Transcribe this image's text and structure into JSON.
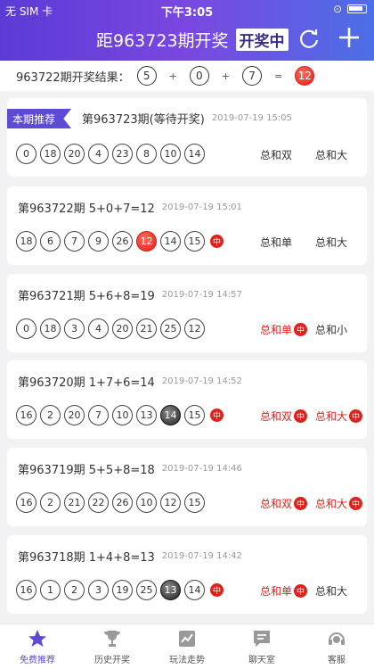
{
  "status": {
    "carrier": "无 SIM 卡",
    "time": "下午3:05"
  },
  "header": {
    "title": "距963723期开奖",
    "badge": "开奖中"
  },
  "result": {
    "label": "963722期开奖结果：",
    "n1": "5",
    "n2": "0",
    "n3": "7",
    "sum": "12",
    "op_plus": "+",
    "op_eq": "="
  },
  "current": {
    "tag": "本期推荐",
    "title": "第963723期(等待开奖)",
    "time": "2019-07-19 15:05",
    "balls": [
      "0",
      "18",
      "20",
      "4",
      "23",
      "8",
      "10",
      "14"
    ],
    "tag1": "总和双",
    "tag2": "总和大"
  },
  "history": [
    {
      "title": "第963722期 5+0+7=12",
      "time": "2019-07-19 15:01",
      "balls": [
        "18",
        "6",
        "7",
        "9",
        "26",
        "12",
        "14",
        "15"
      ],
      "ball_styles": [
        "",
        "",
        "",
        "",
        "",
        "red",
        "",
        ""
      ],
      "last_hit": true,
      "tag1": "总和单",
      "tag1_hit": false,
      "tag2": "总和大",
      "tag2_hit": false
    },
    {
      "title": "第963721期 5+6+8=19",
      "time": "2019-07-19 14:57",
      "balls": [
        "0",
        "18",
        "3",
        "4",
        "20",
        "21",
        "25",
        "12"
      ],
      "ball_styles": [
        "",
        "",
        "",
        "",
        "",
        "",
        "",
        ""
      ],
      "last_hit": false,
      "tag1": "总和单",
      "tag1_hit": true,
      "tag2": "总和小",
      "tag2_hit": false
    },
    {
      "title": "第963720期 1+7+6=14",
      "time": "2019-07-19 14:52",
      "balls": [
        "16",
        "2",
        "20",
        "7",
        "10",
        "13",
        "14",
        "15"
      ],
      "ball_styles": [
        "",
        "",
        "",
        "",
        "",
        "",
        "black",
        ""
      ],
      "last_hit": true,
      "tag1": "总和双",
      "tag1_hit": true,
      "tag2": "总和大",
      "tag2_hit": true
    },
    {
      "title": "第963719期 5+5+8=18",
      "time": "2019-07-19 14:46",
      "balls": [
        "16",
        "2",
        "21",
        "22",
        "26",
        "10",
        "12",
        "15"
      ],
      "ball_styles": [
        "",
        "",
        "",
        "",
        "",
        "",
        "",
        ""
      ],
      "last_hit": false,
      "tag1": "总和双",
      "tag1_hit": true,
      "tag2": "总和大",
      "tag2_hit": true
    },
    {
      "title": "第963718期 1+4+8=13",
      "time": "2019-07-19 14:42",
      "balls": [
        "16",
        "1",
        "2",
        "3",
        "19",
        "25",
        "13",
        "14"
      ],
      "ball_styles": [
        "",
        "",
        "",
        "",
        "",
        "",
        "black",
        ""
      ],
      "last_hit": true,
      "tag1": "总和单",
      "tag1_hit": true,
      "tag2": "总和大",
      "tag2_hit": false
    }
  ],
  "hit_mark": "中",
  "tabs": [
    "免费推荐",
    "历史开奖",
    "玩法走势",
    "聊天室",
    "客服"
  ],
  "colors": {
    "accent": "#5d4bd6",
    "red": "#e0201a"
  }
}
